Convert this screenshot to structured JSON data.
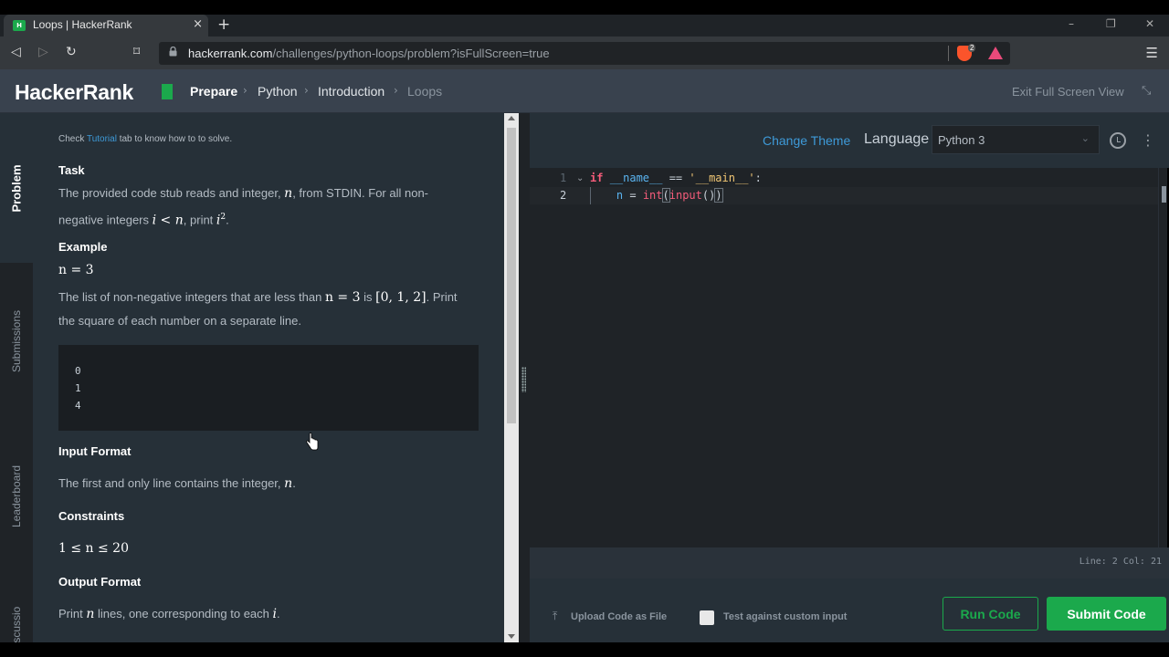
{
  "browser": {
    "tab_title": "Loops | HackerRank",
    "tab_favicon_text": "H",
    "close_glyph": "×",
    "new_tab_glyph": "+",
    "url_host": "hackerrank.com",
    "url_path": "/challenges/python-loops/problem?isFullScreen=true",
    "brave_shield_count": "2"
  },
  "header": {
    "logo": "HackerRank",
    "breadcrumb": [
      "Prepare",
      "Python",
      "Introduction",
      "Loops"
    ],
    "exit_full_screen": "Exit Full Screen View"
  },
  "sidenav": {
    "items": [
      "Problem",
      "Submissions",
      "Leaderboard",
      "Discussions"
    ]
  },
  "problem": {
    "hint_prefix": "Check ",
    "hint_link": "Tutorial",
    "hint_suffix": " tab to know how to to solve.",
    "task_heading": "Task",
    "task_text_1": "The provided code stub reads and integer, ",
    "task_text_2": ", from STDIN. For all non-",
    "task_text_3": "negative integers ",
    "task_text_4": ", print ",
    "example_heading": "Example",
    "example_eq": "n = 3",
    "example_text_1": "The list of non-negative integers that are less than ",
    "example_text_eq": "n = 3",
    "example_text_2": " is ",
    "example_text_list": "[0, 1, 2]",
    "example_text_3": ". Print",
    "example_text_4": "the square of each number on a separate line.",
    "example_output": [
      "0",
      "1",
      "4"
    ],
    "input_heading": "Input Format",
    "input_text": "The first and only line contains the integer, ",
    "constraints_heading": "Constraints",
    "constraints_text": "1 ≤ n ≤ 20",
    "output_heading": "Output Format",
    "output_text_1": "Print ",
    "output_text_2": " lines, one corresponding to each "
  },
  "editor": {
    "change_theme": "Change Theme",
    "language_label": "Language",
    "language_value": "Python 3",
    "line_numbers": [
      "1",
      "2"
    ],
    "status": "Line: 2 Col: 21"
  },
  "footer": {
    "upload": "Upload Code as File",
    "custom_input": "Test against custom input",
    "run_code": "Run Code",
    "submit_code": "Submit Code"
  },
  "colors": {
    "accent_green": "#1ba94c",
    "link_blue": "#3e9ad8",
    "header_bg": "#39424e",
    "panel_bg": "#263038"
  }
}
